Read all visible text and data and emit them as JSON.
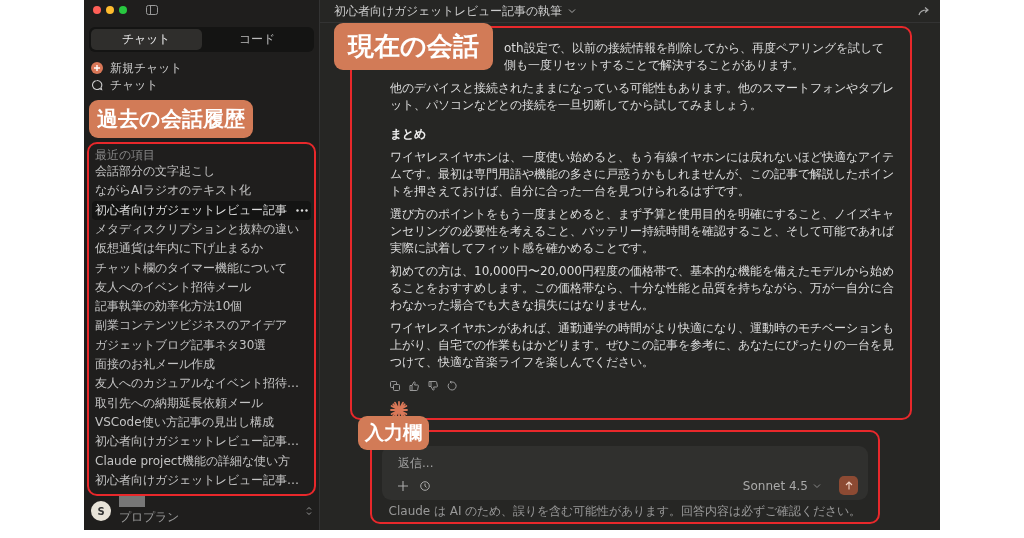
{
  "sidebar": {
    "mode_tabs": [
      {
        "label": "チャット",
        "selected": true
      },
      {
        "label": "コード",
        "selected": false
      }
    ],
    "nav": [
      {
        "label": "新規チャット",
        "kind": "new"
      },
      {
        "label": "チャット",
        "kind": "chats"
      }
    ],
    "history": {
      "callout": "過去の会話履歴",
      "heading": "最近の項目",
      "items": [
        {
          "title": "会話部分の文字起こし",
          "selected": false
        },
        {
          "title": "ながらAIラジオのテキスト化",
          "selected": false
        },
        {
          "title": "初心者向けガジェットレビュー記事",
          "selected": true
        },
        {
          "title": "メタディスクリプションと抜粋の違い",
          "selected": false
        },
        {
          "title": "仮想通貨は年内に下げ止まるか",
          "selected": false
        },
        {
          "title": "チャット欄のタイマー機能について",
          "selected": false
        },
        {
          "title": "友人へのイベント招待メール",
          "selected": false
        },
        {
          "title": "記事執筆の効率化方法10個",
          "selected": false
        },
        {
          "title": "副業コンテンツビジネスのアイデア",
          "selected": false
        },
        {
          "title": "ガジェットブログ記事ネタ30選",
          "selected": false
        },
        {
          "title": "面接のお礼メール作成",
          "selected": false
        },
        {
          "title": "友人へのカジュアルなイベント招待…",
          "selected": false
        },
        {
          "title": "取引先への納期延長依頼メール",
          "selected": false
        },
        {
          "title": "VSCode使い方記事の見出し構成",
          "selected": false
        },
        {
          "title": "初心者向けガジェットレビュー記事…",
          "selected": false
        },
        {
          "title": "Claude project機能の詳細な使い方",
          "selected": false
        },
        {
          "title": "初心者向けガジェットレビュー記事…",
          "selected": false
        }
      ]
    },
    "user": {
      "avatar": "S",
      "plan": "プロプラン"
    }
  },
  "conversation": {
    "title": "初心者向けガジェットレビュー記事の執筆",
    "callout": "現在の会話",
    "blocks": [
      {
        "kind": "partial",
        "lines": [
          "oth設定で、以前の接続情報を削除してから、再度ペアリングを試して",
          "側も一度リセットすることで解決することがあります。"
        ]
      },
      {
        "kind": "paragraph",
        "text": "他のデバイスと接続されたままになっている可能性もあります。他のスマートフォンやタブレット、パソコンなどとの接続を一旦切断してから試してみましょう。"
      },
      {
        "kind": "heading",
        "text": "まとめ"
      },
      {
        "kind": "paragraph",
        "text": "ワイヤレスイヤホンは、一度使い始めると、もう有線イヤホンには戻れないほど快適なアイテムです。最初は専門用語や機能の多さに戸惑うかもしれませんが、この記事で解説したポイントを押さえておけば、自分に合った一台を見つけられるはずです。"
      },
      {
        "kind": "paragraph",
        "text": "選び方のポイントをもう一度まとめると、まず予算と使用目的を明確にすること、ノイズキャンセリングの必要性を考えること、バッテリー持続時間を確認すること、そして可能であれば実際に試着してフィット感を確かめることです。"
      },
      {
        "kind": "paragraph",
        "text": "初めての方は、10,000円〜20,000円程度の価格帯で、基本的な機能を備えたモデルから始めることをおすすめします。この価格帯なら、十分な性能と品質を持ちながら、万が一自分に合わなかった場合でも大きな損失にはなりません。"
      },
      {
        "kind": "paragraph",
        "text": "ワイヤレスイヤホンがあれば、通勤通学の時間がより快適になり、運動時のモチベーションも上がり、自宅での作業もはかどります。ぜひこの記事を参考に、あなたにぴったりの一台を見つけて、快適な音楽ライフを楽しんでください。"
      }
    ]
  },
  "composer": {
    "callout": "入力欄",
    "placeholder": "返信...",
    "model": "Sonnet 4.5",
    "disclaimer": "Claude は AI のため、誤りを含む可能性があります。回答内容は必ずご確認ください。"
  }
}
